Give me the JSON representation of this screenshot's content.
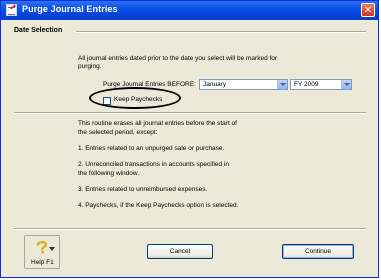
{
  "window": {
    "title": "Purge Journal Entries"
  },
  "date_selection": {
    "section_label": "Date Selection",
    "intro_line1": "All journal entries dated prior to the date you select will be marked for",
    "intro_line2": "purging.",
    "before_label": "Purge Journal Entries BEFORE:",
    "month_value": "January",
    "year_value": "FY 2009",
    "keep_paychecks_label": "Keep Paychecks",
    "keep_paychecks_checked": false
  },
  "info": {
    "line1": "This routine erases all journal entries before the start of",
    "line2": "the selected period, except:",
    "items": [
      "1.  Entries related to an unpurged sale or purchase.",
      "2.  Unreconciled transactions in accounts specified in",
      "     the following window.",
      "3.  Entries related to unreimbursed expenses.",
      "4.  Paychecks, if the Keep Paychecks option is selected."
    ]
  },
  "footer": {
    "help_label": "Help F1",
    "cancel_label": "Cancel",
    "continue_label": "Continue"
  }
}
